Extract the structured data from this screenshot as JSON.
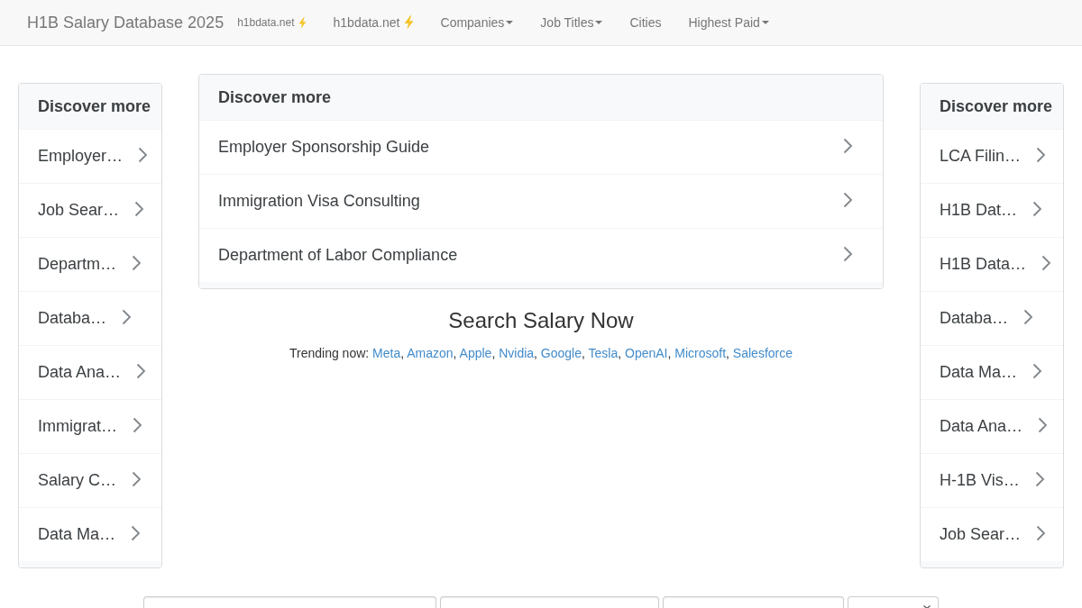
{
  "navbar": {
    "brand": "H1B Salary Database 2025",
    "links": [
      {
        "label": "h1bdata.net",
        "kind": "small_bolt"
      },
      {
        "label": "h1bdata.net",
        "kind": "bolt"
      },
      {
        "label": "Companies",
        "kind": "dropdown"
      },
      {
        "label": "Job Titles",
        "kind": "dropdown"
      },
      {
        "label": "Cities",
        "kind": "plain"
      },
      {
        "label": "Highest Paid",
        "kind": "dropdown"
      }
    ]
  },
  "left_panel": {
    "title": "Discover more",
    "items": [
      "Employer…",
      "Job Sear…",
      "Departm…",
      "Databa…",
      "Data Ana…",
      "Immigrat…",
      "Salary C…",
      "Data Ma…"
    ]
  },
  "center_panel": {
    "title": "Discover more",
    "items": [
      "Employer Sponsorship Guide",
      "Immigration Visa Consulting",
      "Department of Labor Compliance"
    ]
  },
  "right_panel": {
    "title": "Discover more",
    "items": [
      "LCA Filin…",
      "H1B Dat…",
      "H1B Data…",
      "Databa…",
      "Data Ma…",
      "Data Ana…",
      "H-1B Vis…",
      "Job Sear…"
    ]
  },
  "search_heading": "Search Salary Now",
  "trending": {
    "label": "Trending now:",
    "separator": ",",
    "links": [
      "Meta",
      "Amazon",
      "Apple",
      "Nvidia",
      "Google",
      "Tesla",
      "OpenAI",
      "Microsoft",
      "Salesforce"
    ]
  },
  "search_form": {
    "fields": [
      {
        "kind": "text"
      },
      {
        "kind": "text"
      },
      {
        "kind": "text"
      },
      {
        "kind": "select"
      }
    ]
  }
}
